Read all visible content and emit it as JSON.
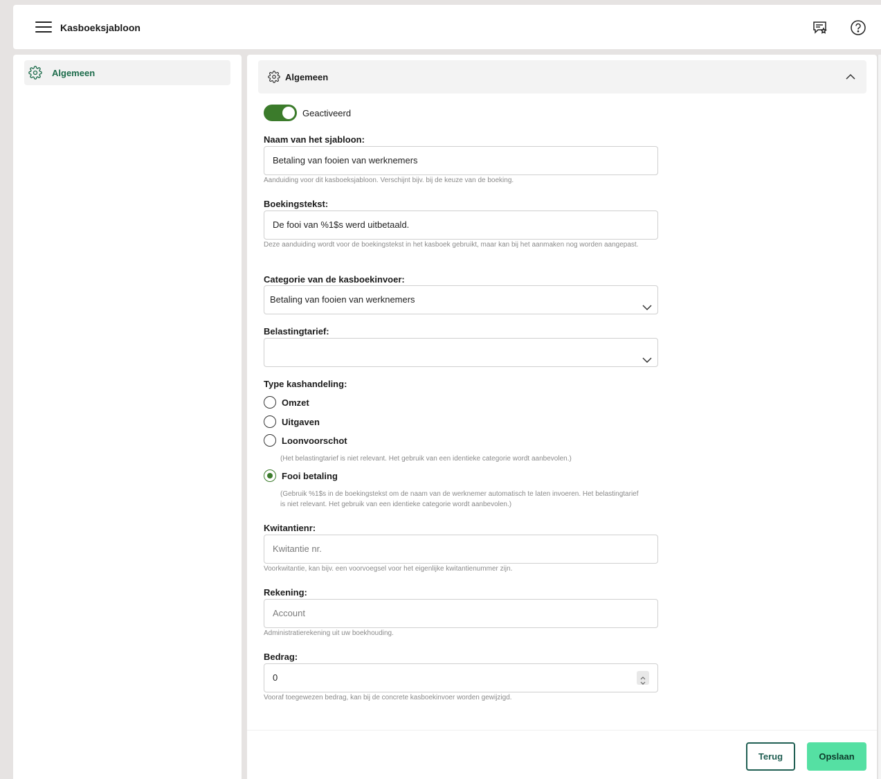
{
  "header": {
    "title": "Kasboeksjabloon"
  },
  "sidebar": {
    "items": [
      {
        "label": "Algemeen",
        "icon": "gear-icon"
      }
    ]
  },
  "section": {
    "title": "Algemeen"
  },
  "form": {
    "active_label": "Geactiveerd",
    "active": true,
    "name": {
      "label": "Naam van het sjabloon:",
      "value": "Betaling van fooien van werknemers",
      "hint": "Aanduiding voor dit kasboeksjabloon. Verschijnt bijv. bij de keuze van de boeking."
    },
    "booking_text": {
      "label": "Boekingstekst:",
      "value": "De fooi van %1$s werd uitbetaald.",
      "hint": "Deze aanduiding wordt voor de boekingstekst in het kasboek gebruikt, maar kan bij het aanmaken nog worden aangepast."
    },
    "category": {
      "label": "Categorie van de kasboekinvoer:",
      "value": "Betaling van fooien van werknemers"
    },
    "tax_rate": {
      "label": "Belastingtarief:",
      "value": ""
    },
    "cash_type": {
      "label": "Type kashandeling:",
      "options": [
        {
          "label": "Omzet",
          "checked": false
        },
        {
          "label": "Uitgaven",
          "checked": false
        },
        {
          "label": "Loonvoorschot",
          "checked": false,
          "hint": "(Het belastingtarief is niet relevant. Het gebruik van een identieke categorie wordt aanbevolen.)"
        },
        {
          "label": "Fooi betaling",
          "checked": true,
          "hint": "(Gebruik %1$s in de boekingstekst om de naam van de werknemer automatisch te laten invoeren. Het belastingtarief is niet relevant. Het gebruik van een identieke categorie wordt aanbevolen.)"
        }
      ]
    },
    "receipt_no": {
      "label": "Kwitantienr:",
      "placeholder": "Kwitantie nr.",
      "hint": "Voorkwitantie, kan bijv. een voorvoegsel voor het eigenlijke kwitantienummer zijn."
    },
    "account": {
      "label": "Rekening:",
      "placeholder": "Account",
      "hint": "Administratierekening uit uw boekhouding."
    },
    "amount": {
      "label": "Bedrag:",
      "value": "0",
      "hint": "Vooraf toegewezen bedrag, kan bij de concrete kasboekinvoer worden gewijzigd."
    }
  },
  "actions": {
    "back_label": "Terug",
    "save_label": "Opslaan"
  },
  "colors": {
    "accent": "#3b7b2b",
    "save": "#55e0a3",
    "back_border": "#1f5e52",
    "sidebar_text": "#1c6b4a"
  }
}
